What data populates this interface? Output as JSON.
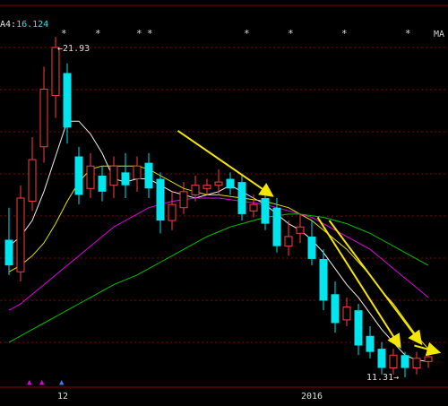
{
  "header": {
    "ma_prefix": "A4:",
    "ma_value": "16.124",
    "ma_tag": "MA"
  },
  "stars": [
    "*",
    "*",
    "*",
    "*",
    "*",
    "*",
    "*",
    "*"
  ],
  "annotations": {
    "high_label": "21.93",
    "low_label": "11.31"
  },
  "colors": {
    "up": "#ff3c3c",
    "down": "#00e5ee",
    "ma5": "#f0f0f0",
    "ma10": "#e8e000",
    "ma20": "#e000e0",
    "ma60": "#00c000",
    "arrow": "#f5e600",
    "grid": "#8a0000"
  },
  "chart_data": {
    "type": "candlestick",
    "x_tick_labels": [
      "12",
      "2016"
    ],
    "y_range": [
      11.0,
      22.8
    ],
    "grid": "horizontal dashed",
    "candles": [
      {
        "o": 15.6,
        "c": 14.8,
        "h": 16.6,
        "l": 14.5
      },
      {
        "o": 14.6,
        "c": 16.9,
        "h": 17.3,
        "l": 14.3
      },
      {
        "o": 16.8,
        "c": 18.1,
        "h": 18.8,
        "l": 16.5
      },
      {
        "o": 18.5,
        "c": 20.3,
        "h": 21.0,
        "l": 18.0
      },
      {
        "o": 20.1,
        "c": 21.6,
        "h": 21.93,
        "l": 19.4
      },
      {
        "o": 20.8,
        "c": 19.1,
        "h": 21.1,
        "l": 18.6
      },
      {
        "o": 18.2,
        "c": 17.0,
        "h": 18.5,
        "l": 16.7
      },
      {
        "o": 17.2,
        "c": 17.9,
        "h": 18.3,
        "l": 16.9
      },
      {
        "o": 17.6,
        "c": 17.1,
        "h": 17.9,
        "l": 16.8
      },
      {
        "o": 17.3,
        "c": 17.9,
        "h": 18.2,
        "l": 16.9
      },
      {
        "o": 17.7,
        "c": 17.3,
        "h": 18.3,
        "l": 16.9
      },
      {
        "o": 17.5,
        "c": 17.9,
        "h": 18.2,
        "l": 17.1
      },
      {
        "o": 18.0,
        "c": 17.2,
        "h": 18.3,
        "l": 16.9
      },
      {
        "o": 17.5,
        "c": 16.2,
        "h": 17.7,
        "l": 15.8
      },
      {
        "o": 16.2,
        "c": 16.7,
        "h": 17.1,
        "l": 15.9
      },
      {
        "o": 16.6,
        "c": 17.1,
        "h": 17.4,
        "l": 16.4
      },
      {
        "o": 17.0,
        "c": 17.3,
        "h": 17.6,
        "l": 16.8
      },
      {
        "o": 17.2,
        "c": 17.3,
        "h": 17.5,
        "l": 17.0
      },
      {
        "o": 17.3,
        "c": 17.4,
        "h": 17.8,
        "l": 17.0
      },
      {
        "o": 17.5,
        "c": 17.2,
        "h": 17.7,
        "l": 17.0
      },
      {
        "o": 17.4,
        "c": 16.4,
        "h": 17.6,
        "l": 16.2
      },
      {
        "o": 16.5,
        "c": 16.7,
        "h": 17.0,
        "l": 16.3
      },
      {
        "o": 16.9,
        "c": 16.1,
        "h": 17.1,
        "l": 15.9
      },
      {
        "o": 16.6,
        "c": 15.4,
        "h": 16.9,
        "l": 15.2
      },
      {
        "o": 15.4,
        "c": 15.7,
        "h": 16.2,
        "l": 15.1
      },
      {
        "o": 15.8,
        "c": 16.0,
        "h": 16.4,
        "l": 15.5
      },
      {
        "o": 15.7,
        "c": 15.0,
        "h": 16.2,
        "l": 14.8
      },
      {
        "o": 15.0,
        "c": 13.7,
        "h": 15.3,
        "l": 13.4
      },
      {
        "o": 13.9,
        "c": 13.0,
        "h": 14.3,
        "l": 12.7
      },
      {
        "o": 13.1,
        "c": 13.5,
        "h": 13.8,
        "l": 12.9
      },
      {
        "o": 13.4,
        "c": 12.3,
        "h": 13.6,
        "l": 12.0
      },
      {
        "o": 12.6,
        "c": 12.1,
        "h": 12.9,
        "l": 11.9
      },
      {
        "o": 12.2,
        "c": 11.6,
        "h": 12.4,
        "l": 11.4
      },
      {
        "o": 11.6,
        "c": 12.0,
        "h": 12.2,
        "l": 11.4
      },
      {
        "o": 12.0,
        "c": 11.6,
        "h": 12.1,
        "l": 11.31
      },
      {
        "o": 11.6,
        "c": 11.9,
        "h": 12.1,
        "l": 11.4
      },
      {
        "o": 11.8,
        "c": 11.95,
        "h": 12.0,
        "l": 11.6
      }
    ],
    "ma_series": [
      {
        "key": "ma5",
        "values": [
          15.4,
          15.7,
          16.2,
          17.1,
          18.2,
          19.3,
          19.3,
          18.9,
          18.3,
          17.5,
          17.4,
          17.5,
          17.5,
          17.3,
          17.1,
          17.0,
          16.9,
          17.0,
          17.1,
          17.3,
          17.1,
          16.9,
          16.7,
          16.4,
          16.1,
          15.9,
          15.6,
          15.2,
          14.7,
          14.2,
          13.8,
          13.3,
          12.8,
          12.4,
          12.0,
          11.85,
          11.8
        ]
      },
      {
        "key": "ma10",
        "values": [
          14.6,
          14.8,
          15.1,
          15.5,
          16.1,
          16.8,
          17.4,
          17.8,
          17.9,
          17.9,
          17.9,
          17.9,
          17.8,
          17.6,
          17.4,
          17.2,
          17.1,
          17.0,
          17.0,
          16.95,
          16.9,
          16.85,
          16.8,
          16.7,
          16.6,
          16.4,
          16.2,
          15.9,
          15.6,
          15.3,
          14.9,
          14.5,
          14.0,
          13.6,
          13.1,
          12.6,
          12.2
        ]
      },
      {
        "key": "ma20",
        "values": [
          13.4,
          13.6,
          13.9,
          14.2,
          14.5,
          14.8,
          15.1,
          15.4,
          15.7,
          16.0,
          16.2,
          16.4,
          16.6,
          16.7,
          16.8,
          16.85,
          16.9,
          16.9,
          16.9,
          16.85,
          16.8,
          16.75,
          16.7,
          16.6,
          16.5,
          16.4,
          16.3,
          16.1,
          15.9,
          15.7,
          15.5,
          15.3,
          15.0,
          14.7,
          14.4,
          14.1,
          13.8
        ]
      },
      {
        "key": "ma60",
        "values": [
          12.4,
          12.6,
          12.8,
          13.0,
          13.2,
          13.4,
          13.6,
          13.8,
          14.0,
          14.2,
          14.35,
          14.5,
          14.7,
          14.9,
          15.1,
          15.3,
          15.5,
          15.7,
          15.85,
          16.0,
          16.1,
          16.2,
          16.3,
          16.35,
          16.4,
          16.4,
          16.35,
          16.3,
          16.2,
          16.1,
          15.95,
          15.8,
          15.6,
          15.4,
          15.2,
          15.0,
          14.8
        ]
      }
    ]
  }
}
